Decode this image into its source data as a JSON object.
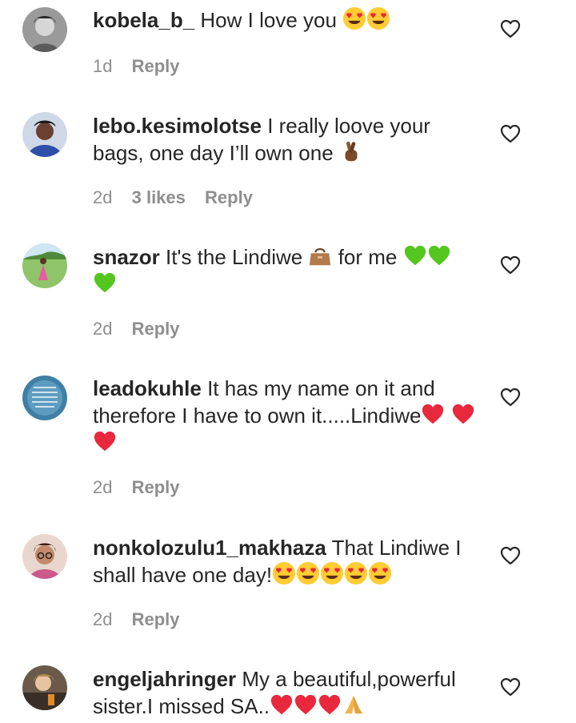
{
  "comments": [
    {
      "username": "kobela_b_",
      "text": "How I love you",
      "emojis": [
        "heart-eyes",
        "heart-eyes"
      ],
      "time": "1d",
      "likes": "",
      "reply_label": "Reply"
    },
    {
      "username": "lebo.kesimolotse",
      "text": "I really loove your bags, one day I’ll own one",
      "emojis": [
        "crossed-fingers"
      ],
      "time": "2d",
      "likes": "3 likes",
      "reply_label": "Reply"
    },
    {
      "username": "snazor",
      "text_before": "It's the Lindiwe",
      "text_after": "for me",
      "emojis": [
        "handbag",
        "green-heart",
        "green-heart",
        "green-heart"
      ],
      "time": "2d",
      "likes": "",
      "reply_label": "Reply"
    },
    {
      "username": "leadokuhle",
      "text": "It has my name on it and therefore I have to own it.....Lindiwe",
      "emojis": [
        "red-heart",
        "red-heart",
        "red-heart"
      ],
      "time": "2d",
      "likes": "",
      "reply_label": "Reply"
    },
    {
      "username": "nonkolozulu1_makhaza",
      "text": "That Lindiwe I shall have one day!",
      "emojis": [
        "heart-eyes",
        "heart-eyes",
        "heart-eyes",
        "heart-eyes",
        "heart-eyes"
      ],
      "time": "2d",
      "likes": "",
      "reply_label": "Reply"
    },
    {
      "username": "engeljahringer",
      "text": "My a beautiful,powerful sister.I missed SA..",
      "emojis": [
        "red-heart",
        "red-heart",
        "red-heart",
        "folded-hands"
      ],
      "time": "",
      "likes": "",
      "reply_label": ""
    }
  ],
  "colors": {
    "text": "#262626",
    "meta": "#8e8e8e",
    "heart_outline": "#262626"
  },
  "icons": {
    "like": "heart-outline-icon"
  }
}
